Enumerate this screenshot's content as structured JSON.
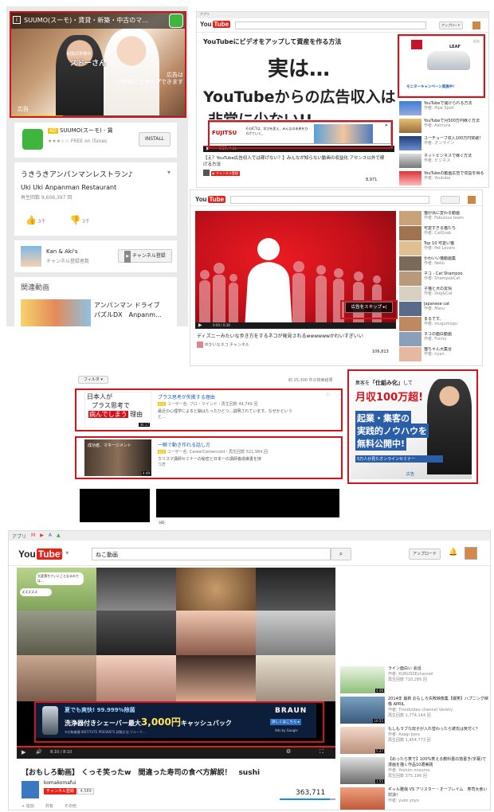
{
  "panel_mobile": {
    "video_title_overlay": "SUUMO(スーモ)・賃貸・新築・中古のマ…",
    "caption_name": "スドーさん",
    "caption_small": "結婚式準備中",
    "skip_text_line1": "広告は",
    "skip_text_line2": "3秒後にスキップできます",
    "ad_label": "広告",
    "app_ad_badge": "AD",
    "app_name": "SUUMO(スーモ) - 賃",
    "app_rating": "★★★☆☆",
    "app_source": "FREE on iTunes",
    "install_button": "INSTALL",
    "video_title": "うきうきアンパンマンレストラン♪",
    "video_subtitle": "Uki Uki Anpanman Restaurant",
    "view_count": "再生回数 9,606,397 回",
    "likes": "3千",
    "dislikes": "3千",
    "channel_name": "Kan & Aki's",
    "channel_subs": "チャンネル登録者数",
    "subscribe_button": "チャンネル登録",
    "related_heading": "関連動画",
    "related_title": "アンパンマン ドライブ",
    "related_title2": "パズルDX　Anpanm…"
  },
  "panel_desktop1": {
    "browser_tab": "アプリ",
    "upload_button": "アップロード",
    "heading": "YouTubeにビデオをアップして資産を作る方法",
    "big_line1": "実は…",
    "big_line2": "YouTubeからの広告収入は",
    "big_line3": "非常に少ない!!",
    "overlay_brand": "FUJITSU",
    "overlay_text": "そのICTは、学びを変え、みんなの未来をひろげていく。",
    "time": "0:14 / 7:10",
    "video_title": "【え？YouTube広告収入では稼げない？】みんなが知らない動画の収益化 アセンス以外で稼げる方法",
    "view_count": "8,971",
    "banner_label": "広告",
    "banner_car": "LEAF",
    "banner_text": "モニターキャンペーン実施中!",
    "related": [
      {
        "title": "YouTubeで儲けられる方法",
        "meta": "作者: Pipe Spoil"
      },
      {
        "title": "YouTubeで月500万円稼ぐ方法",
        "meta": "作者: Ashruns"
      },
      {
        "title": "ユーチューブ収入100万円突破！",
        "meta": "作者: オンライン"
      },
      {
        "title": "ネットビジネスで稼ぐ方法",
        "meta": "作者: ビジネス"
      },
      {
        "title": "YouTubeの動画広告で収益を得る",
        "meta": "作者: Youtube"
      }
    ]
  },
  "panel_desktop2": {
    "skip_button": "広告をスキップ ▸|",
    "time": "0:09 / 0:38",
    "video_title": "ディズニーみたいな歩き方をするネコが発見されるwwwwwwかわいすぎいい",
    "channel": "ゆかいなネコ チャンネル",
    "view_count": "106,813",
    "related": [
      {
        "title": "猫が鳥に変わる動画",
        "meta": "作者: Fabulous team"
      },
      {
        "title": "可愛すぎる猫たち",
        "meta": "作者: CatGrab"
      },
      {
        "title": "Top 10 可愛い猫",
        "meta": "作者: Pet Lovers"
      },
      {
        "title": "かわいい猫動画集",
        "meta": "作者: Neko"
      },
      {
        "title": "ネコ - Cat Shampoo",
        "meta": "作者: ShampooCat"
      },
      {
        "title": "子猫と犬の友情",
        "meta": "作者: Dog&Cat"
      },
      {
        "title": "Japanese cat",
        "meta": "作者: Maru"
      },
      {
        "title": "まるです。",
        "meta": "作者: mugumogu"
      },
      {
        "title": "ネコの面白動画",
        "meta": "作者: Funny"
      },
      {
        "title": "猫ちゃん大集合",
        "meta": "作者: nyan"
      }
    ]
  },
  "panel_search": {
    "filter_button": "フィルタ ▾",
    "results_count": "約 25,300 件の検索結果",
    "result1_thumb_line1": "日本人が",
    "result1_thumb_line2": "プラス思考で",
    "result1_thumb_line3": "病んでしまう",
    "result1_thumb_line4": "理由",
    "result1_duration": "30:17",
    "result1_title": "プラス思考が失敗する理由",
    "result1_meta": "ユーザー名: ブロ・マインド・再生回数 44,749 回",
    "result1_desc": "最近の心理学によると脳はたったひとつ…説明されています。なぜかというと…",
    "result2_thumb_text": "成功者、マネージメント",
    "result2_duration": "4:49",
    "result2_title": "一瞬で動き作れる話し方",
    "result2_meta": "ユーザー名: CareerCentercotd・再生回数 521,984 回",
    "result2_desc": "カリスマ講師セミナーの秘密と日本一の講師養成維書を持つ方",
    "ad_badge": "広告",
    "hd_badge": "HD",
    "side_ad": {
      "line1a": "集客を",
      "line1b": "「仕組み化」",
      "line1c": "して",
      "line2": "月収100万超!",
      "line3": "起業・集客の",
      "line4": "実践的ノウハウを",
      "line5": "無料公開中!",
      "line6": "5万人が見たオンラインセミナー",
      "label": "広告"
    }
  },
  "panel_cat": {
    "browser_tabs": [
      "アプリ",
      "M",
      "▶",
      "A",
      "▲"
    ],
    "search_query": "ねこ動画",
    "upload_button": "アップロード",
    "ad_line1": "夏でも爽快! 99.999%除菌",
    "ad_line2": "洗浄器付きシェーバー最大",
    "ad_amount": "3,000円",
    "ad_line3": "キャッシュバック",
    "ad_small": "※対象機種:INSTITUTE PRESENTS 試験方法:ブルーフ…",
    "ad_brand": "BRAUN",
    "ad_more": "詳しくはこちら ▸",
    "ad_by_google": "Ads by Google",
    "time": "8:10 / 8:10",
    "grid_captions": [
      "大変落ちていくことなるのでは…",
      "ズズズズズ"
    ],
    "video_title": "【おもしろ動画】 くっそ笑ったw　間違った寿司の食べ方解説！　sushi",
    "channel": "komakomafui",
    "subscribe": "チャンネル登録",
    "sub_count": "4,589",
    "view_count": "363,711",
    "actions": [
      "+ 追加",
      "共有",
      "その他"
    ],
    "related": [
      {
        "title": "ライン面白い 会話",
        "meta": "作者: KURUSSEchannel",
        "views": "再生回数 710,286 回",
        "dur": "4:08"
      },
      {
        "title": "2014年 最新 おもしろ失敗映像集【爆笑】ハプニング映像 APRIL",
        "meta": "作者: Timidvideo channel Variety",
        "views": "再生回数 1,774,144 回",
        "dur": "10:55"
      },
      {
        "title": "もしもラブな双子が入れ替わったら彼氏は気付く？",
        "meta": "作者: Asagi bara",
        "views": "再生回数 1,454,773 回",
        "dur": "5:27"
      },
      {
        "title": "【めったら笑で】100%笑える教科書の落書き(字幕)で漫画を描く作品10選実践",
        "meta": "作者: Yoshim mizumo",
        "views": "再生回数 375,196 回",
        "dur": "1:55"
      },
      {
        "title": "ギャル雅哉 VS アリスター・オーフレイム　寿司大食い対決！",
        "meta": "作者: yuko yoyo",
        "views": "",
        "dur": ""
      }
    ]
  }
}
